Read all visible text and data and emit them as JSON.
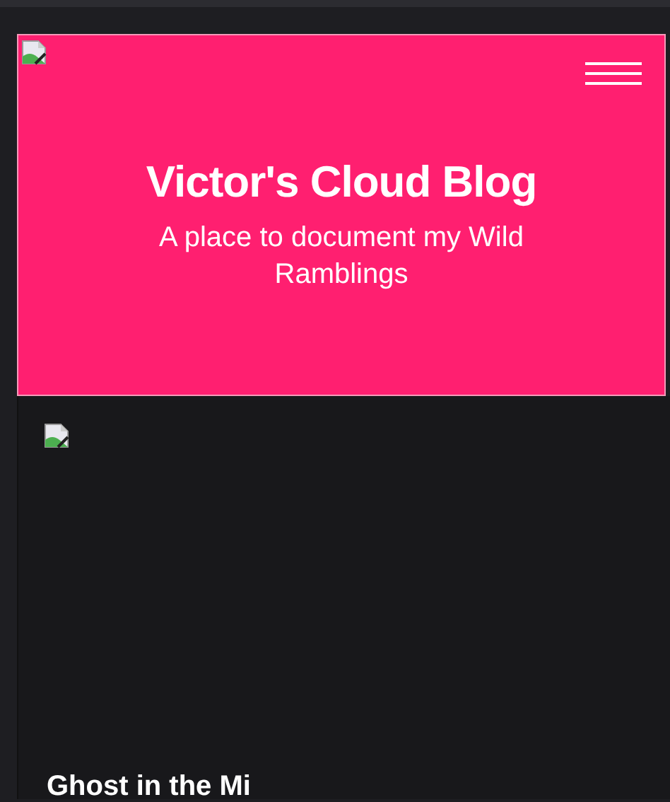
{
  "header": {
    "title": "Victor's Cloud Blog",
    "subtitle": "A place to document my Wild Ramblings"
  },
  "post": {
    "title": "Ghost in the Mi"
  }
}
